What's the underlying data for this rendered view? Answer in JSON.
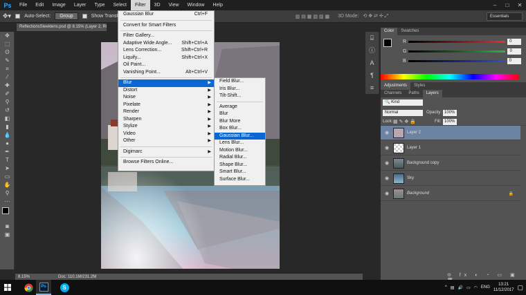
{
  "app": {
    "logo": "Ps"
  },
  "menubar": [
    "File",
    "Edit",
    "Image",
    "Layer",
    "Type",
    "Select",
    "Filter",
    "3D",
    "View",
    "Window",
    "Help"
  ],
  "window_controls": [
    "–",
    "□",
    "✕"
  ],
  "options": {
    "autoselect_label": "Auto-Select:",
    "autoselect_value": "Group",
    "show_transform_label": "Show Transform Controls",
    "mode_3d": "3D Mode:"
  },
  "workspace": "Essentials",
  "doc_tab": "ReflectionsSleeklens.psd @ 8.15% (Layer 2, RGB/8) *",
  "status": {
    "zoom": "8.15%",
    "doc": "Doc: 110.1M/231.2M"
  },
  "filter_menu": {
    "top": [
      {
        "label": "Gaussian Blur",
        "shortcut": "Ctrl+F"
      }
    ],
    "smart": [
      {
        "label": "Convert for Smart Filters",
        "shortcut": ""
      }
    ],
    "filters": [
      {
        "label": "Filter Gallery...",
        "shortcut": ""
      },
      {
        "label": "Adaptive Wide Angle...",
        "shortcut": "Shift+Ctrl+A"
      },
      {
        "label": "Lens Correction...",
        "shortcut": "Shift+Ctrl+R"
      },
      {
        "label": "Liquify...",
        "shortcut": "Shift+Ctrl+X"
      },
      {
        "label": "Oil Paint...",
        "shortcut": ""
      },
      {
        "label": "Vanishing Point...",
        "shortcut": "Alt+Ctrl+V"
      }
    ],
    "groups": [
      "Blur",
      "Distort",
      "Noise",
      "Pixelate",
      "Render",
      "Sharpen",
      "Stylize",
      "Video",
      "Other"
    ],
    "digimarc": [
      "Digimarc"
    ],
    "browse": [
      "Browse Filters Online..."
    ]
  },
  "blur_submenu": {
    "gallery": [
      "Field Blur...",
      "Iris Blur...",
      "Tilt-Shift..."
    ],
    "items": [
      "Average",
      "Blur",
      "Blur More",
      "Box Blur...",
      "Gaussian Blur...",
      "Lens Blur...",
      "Motion Blur...",
      "Radial Blur...",
      "Shape Blur...",
      "Smart Blur...",
      "Surface Blur..."
    ],
    "highlighted": "Gaussian Blur..."
  },
  "color_panel": {
    "tabs": [
      "Color",
      "Swatches"
    ],
    "channels": [
      {
        "label": "R",
        "value": "0",
        "color": "#e53030"
      },
      {
        "label": "G",
        "value": "0",
        "color": "#2fb43a"
      },
      {
        "label": "B",
        "value": "0",
        "color": "#2d4fd6"
      }
    ]
  },
  "adj_panel": {
    "tabs": [
      "Adjustments",
      "Styles"
    ]
  },
  "layers_panel": {
    "tabs": [
      "Channels",
      "Paths",
      "Layers"
    ],
    "kind": "Kind",
    "blend": "Normal",
    "opacity_label": "Opacity:",
    "opacity": "100%",
    "lock_label": "Lock:",
    "fill_label": "Fill:",
    "fill": "100%",
    "layers": [
      {
        "name": "Layer 2",
        "selected": true
      },
      {
        "name": "Layer 1",
        "selected": false
      },
      {
        "name": "Background copy",
        "selected": false
      },
      {
        "name": "Sky",
        "selected": false
      },
      {
        "name": "Background",
        "selected": false
      }
    ],
    "footer_icons": [
      "link-icon",
      "fx-icon",
      "mask-icon",
      "adjustment-icon",
      "folder-icon",
      "new-layer-icon",
      "trash-icon"
    ]
  },
  "tray": {
    "lang": "ENG",
    "time": "13:21",
    "date": "11/12/2017"
  }
}
